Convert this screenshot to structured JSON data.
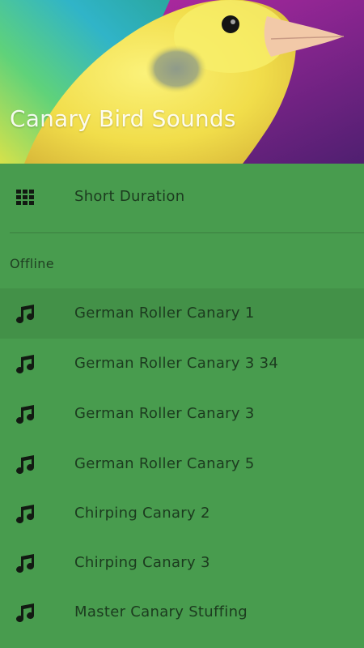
{
  "header": {
    "title": "Canary Bird Sounds",
    "image": "yellow-canary-bird"
  },
  "menu": {
    "short_duration": {
      "label": "Short Duration",
      "icon": "grid-icon"
    },
    "offline_section": {
      "header": "Offline",
      "items": [
        {
          "label": "German Roller Canary 1",
          "icon": "music-note-icon"
        },
        {
          "label": "German Roller Canary 3 34",
          "icon": "music-note-icon"
        },
        {
          "label": "German Roller Canary 3",
          "icon": "music-note-icon"
        },
        {
          "label": "German Roller Canary 5",
          "icon": "music-note-icon"
        },
        {
          "label": "Chirping Canary 2",
          "icon": "music-note-icon"
        },
        {
          "label": "Chirping Canary 3",
          "icon": "music-note-icon"
        },
        {
          "label": "Master Canary Stuffing",
          "icon": "music-note-icon"
        }
      ]
    }
  },
  "colors": {
    "drawer_background": "#489c4e",
    "highlight_background": "#439148",
    "icon_color": "#121a12",
    "text_color": "#1c3b1f",
    "title_color": "#ffffff"
  }
}
